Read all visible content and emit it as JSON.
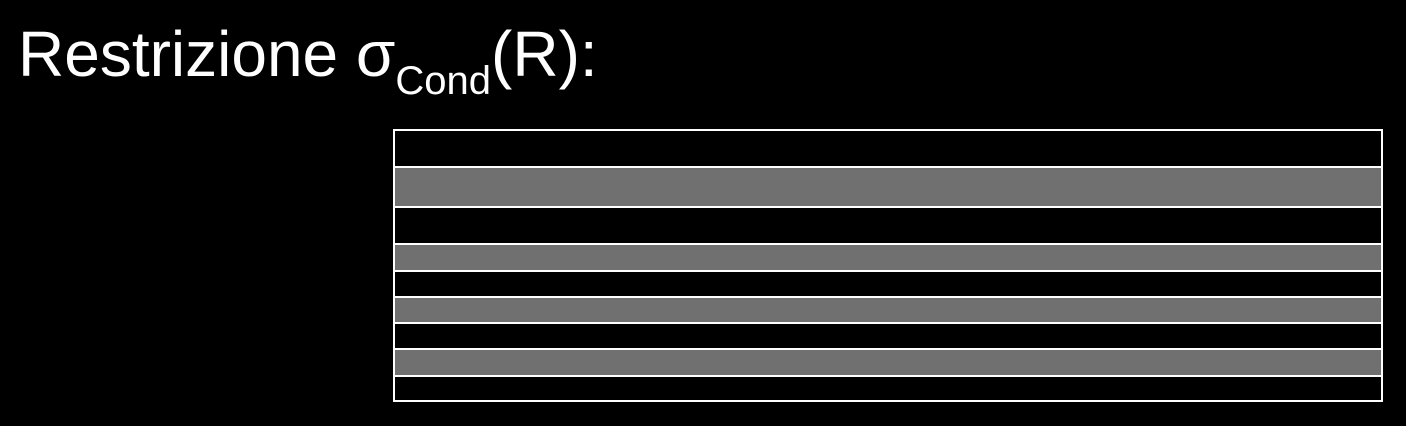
{
  "title": {
    "prefix": "Restrizione σ",
    "subscript": "Cond",
    "suffix": "(R):"
  },
  "relation": {
    "rows": [
      {
        "selected": false,
        "weight": 38
      },
      {
        "selected": true,
        "weight": 40
      },
      {
        "selected": false,
        "weight": 38
      },
      {
        "selected": true,
        "weight": 26
      },
      {
        "selected": false,
        "weight": 26
      },
      {
        "selected": true,
        "weight": 26
      },
      {
        "selected": false,
        "weight": 26
      },
      {
        "selected": true,
        "weight": 26
      },
      {
        "selected": false,
        "weight": 25
      }
    ],
    "colors": {
      "border": "#ffffff",
      "selected_row": "#707070",
      "unselected_row": "#000000"
    }
  }
}
